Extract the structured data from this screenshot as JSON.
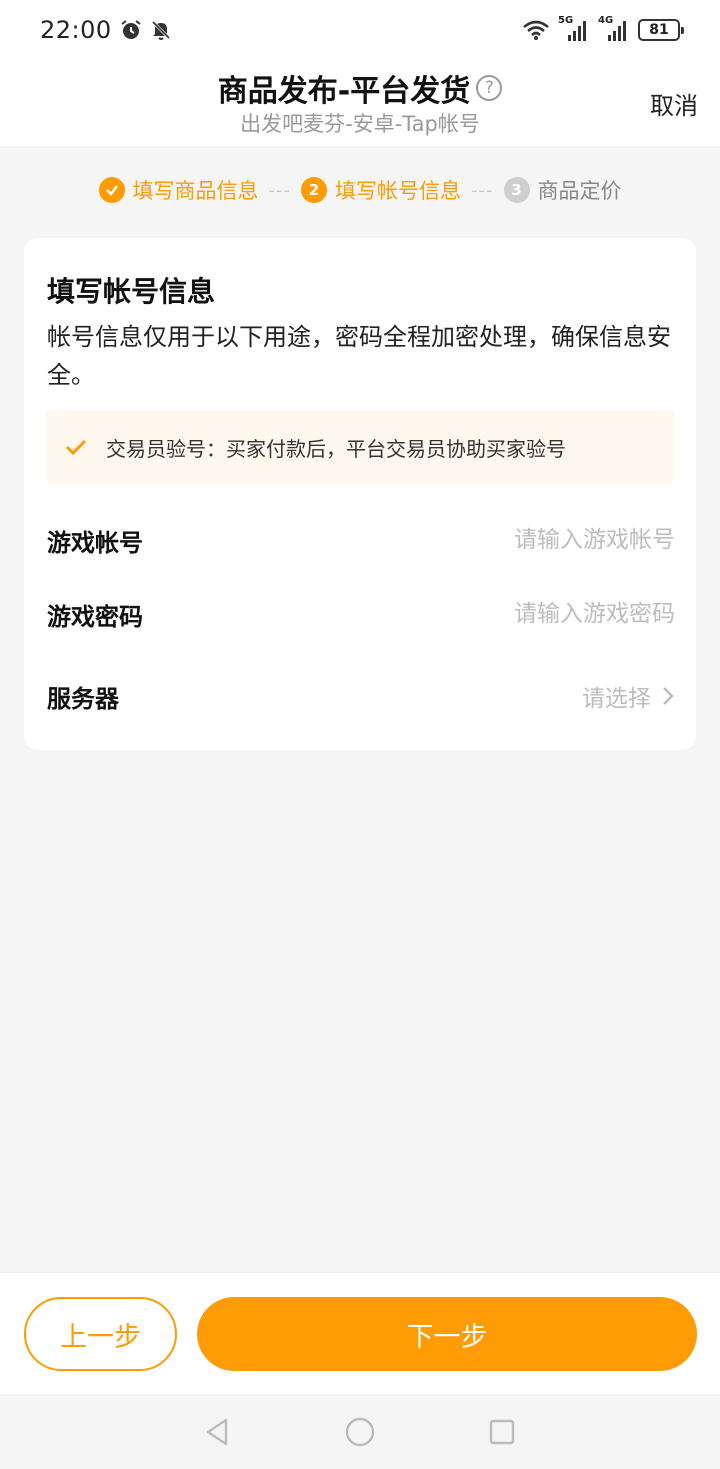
{
  "status_bar": {
    "time": "22:00",
    "network_1": "5G",
    "network_2": "4G",
    "battery": "81",
    "icons": [
      "alarm-icon",
      "mute-icon",
      "wifi-icon",
      "signal-icon",
      "battery-icon"
    ]
  },
  "header": {
    "title": "商品发布-平台发货",
    "subtitle": "出发吧麦芬-安卓-Tap帐号",
    "help_icon": "?",
    "cancel_label": "取消"
  },
  "steps": [
    {
      "number": "1",
      "label": "填写商品信息",
      "state": "done"
    },
    {
      "number": "2",
      "label": "填写帐号信息",
      "state": "current"
    },
    {
      "number": "3",
      "label": "商品定价",
      "state": "pending"
    }
  ],
  "step_separator": "---",
  "card": {
    "title": "填写帐号信息",
    "description": "帐号信息仅用于以下用途，密码全程加密处理，确保信息安全。",
    "notice": "交易员验号：买家付款后，平台交易员协助买家验号"
  },
  "form": {
    "account_label": "游戏帐号",
    "account_placeholder": "请输入游戏帐号",
    "password_label": "游戏密码",
    "password_placeholder": "请输入游戏密码",
    "server_label": "服务器",
    "server_placeholder": "请选择"
  },
  "buttons": {
    "prev_label": "上一步",
    "next_label": "下一步"
  },
  "colors": {
    "accent": "#ff9b05",
    "notice_bg": "#fff8ee",
    "background": "#f5f5f5"
  }
}
